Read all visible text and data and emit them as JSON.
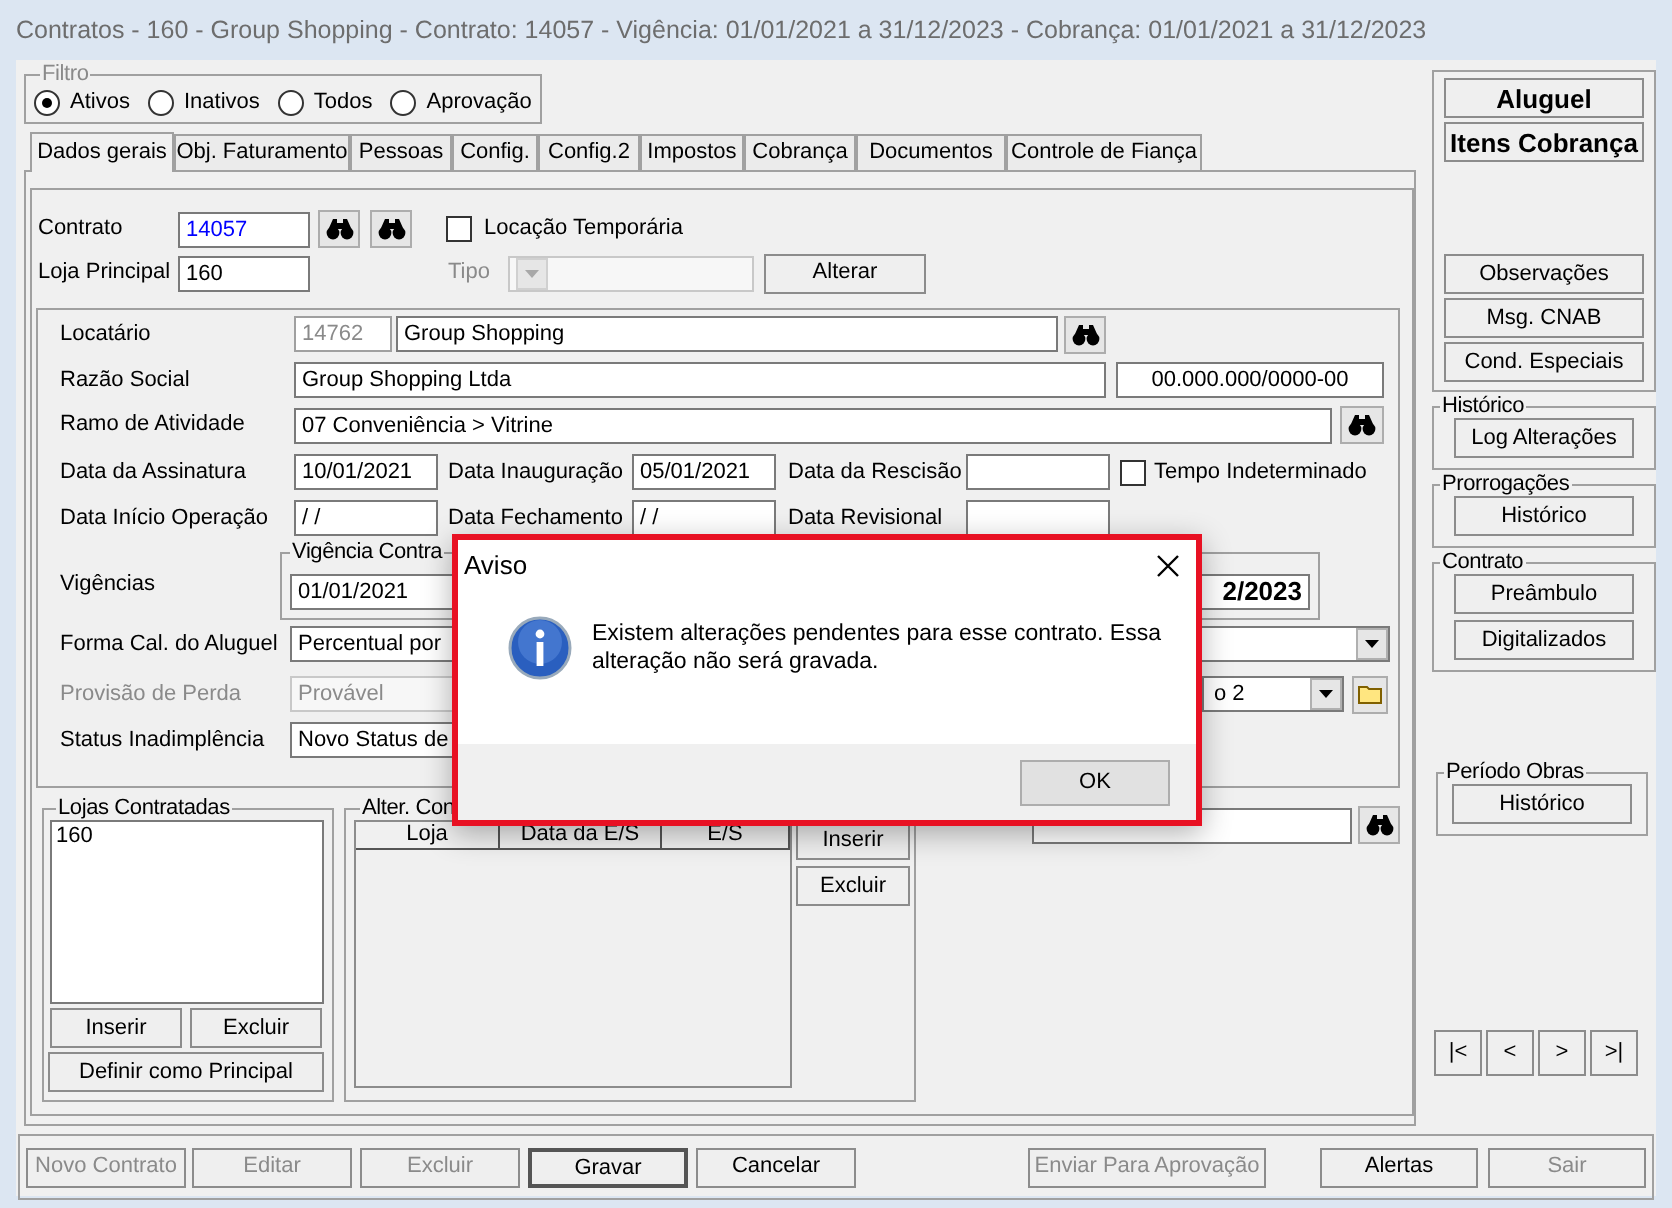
{
  "window": {
    "title": "Contratos - 160 - Group Shopping - Contrato: 14057 - Vigência: 01/01/2021 a 31/12/2023 - Cobrança: 01/01/2021 a 31/12/2023"
  },
  "filter": {
    "label": "Filtro",
    "options": [
      {
        "label": "Ativos",
        "selected": true
      },
      {
        "label": "Inativos",
        "selected": false
      },
      {
        "label": "Todos",
        "selected": false
      },
      {
        "label": "Aprovação",
        "selected": false
      }
    ]
  },
  "tabs": [
    {
      "label": "Dados gerais",
      "selected": true
    },
    {
      "label": "Obj. Faturamento",
      "selected": false
    },
    {
      "label": "Pessoas",
      "selected": false
    },
    {
      "label": "Config.",
      "selected": false
    },
    {
      "label": "Config.2",
      "selected": false
    },
    {
      "label": "Impostos",
      "selected": false
    },
    {
      "label": "Cobrança",
      "selected": false
    },
    {
      "label": "Documentos",
      "selected": false
    },
    {
      "label": "Controle de Fiança",
      "selected": false
    }
  ],
  "contract": {
    "label": "Contrato",
    "value": "14057"
  },
  "temporary_rental": {
    "label": "Locação Temporária",
    "checked": false
  },
  "main_store": {
    "label": "Loja Principal",
    "value": "160"
  },
  "type": {
    "label": "Tipo",
    "disabled": true
  },
  "change_button": {
    "label": "Alterar"
  },
  "tenant": {
    "label": "Locatário",
    "code": "14762",
    "name": "Group Shopping"
  },
  "company_name": {
    "label": "Razão Social",
    "value": "Group Shopping Ltda",
    "tax_id": "00.000.000/0000-00"
  },
  "business": {
    "label": "Ramo de Atividade",
    "value": "07 Conveniência > Vitrine"
  },
  "date_rows": [
    [
      {
        "label": "Data da Assinatura",
        "value": "10/01/2021"
      },
      {
        "label": "Data Inauguração",
        "value": "05/01/2021"
      },
      {
        "label": "Data da Rescisão"
      }
    ],
    [
      {
        "label": "Data Início Operação",
        "value": " /  /"
      },
      {
        "label": "Data Fechamento",
        "value": " /  /"
      },
      {
        "label": "Data Revisional"
      }
    ]
  ],
  "indefinite_term": {
    "label": "Tempo Indeterminado",
    "checked": false
  },
  "terms": {
    "label": "Vigências",
    "group_label": "Vigência Contra",
    "start": "01/01/2021",
    "end": "2/2023"
  },
  "rent_calc": {
    "label": "Forma Cal. do Aluguel",
    "value": "Percentual por"
  },
  "loss_provision": {
    "label": "Provisão de Perda",
    "value": "Provável",
    "disabled": true,
    "second_value": "o 2"
  },
  "default_status": {
    "label": "Status Inadimplência",
    "value": "Novo Status de"
  },
  "stores": {
    "label": "Lojas Contratadas",
    "items": [
      "160"
    ],
    "buttons": [
      "Inserir",
      "Excluir"
    ],
    "set_main": "Definir como Principal"
  },
  "changes": {
    "label": "Alter. Con",
    "columns": [
      "Loja",
      "Data da E/S",
      "E/S"
    ],
    "buttons": [
      "Inserir",
      "Excluir"
    ]
  },
  "side_buttons_top": [
    {
      "label": "Aluguel",
      "bold": true
    },
    {
      "label": "Itens Cobrança",
      "bold": true
    }
  ],
  "side_buttons": [
    "Observações",
    "Msg. CNAB",
    "Cond. Especiais"
  ],
  "side_groups": [
    {
      "label": "Histórico",
      "buttons": [
        "Log Alterações"
      ]
    },
    {
      "label": "Prorrogações",
      "buttons": [
        "Histórico"
      ]
    },
    {
      "label": "Contrato",
      "buttons": [
        "Preâmbulo",
        "Digitalizados"
      ]
    }
  ],
  "works_group": {
    "label": "Período Obras",
    "buttons": [
      "Histórico"
    ]
  },
  "nav_buttons": [
    "|<",
    "<",
    ">",
    ">|"
  ],
  "actions": [
    {
      "label": "Novo Contrato",
      "disabled": true,
      "default": false
    },
    {
      "label": "Editar",
      "disabled": true,
      "default": false
    },
    {
      "label": "Excluir",
      "disabled": true,
      "default": false
    },
    {
      "label": "Gravar",
      "disabled": false,
      "default": true
    },
    {
      "label": "Cancelar",
      "disabled": false,
      "default": false
    },
    {
      "label": "Enviar Para Aprovação",
      "disabled": true,
      "default": false
    },
    {
      "label": "Alertas",
      "disabled": false,
      "default": false
    },
    {
      "label": "Sair",
      "disabled": true,
      "default": false
    }
  ],
  "dialog": {
    "title": "Aviso",
    "message": "Existem alterações pendentes para esse contrato. Essa alteração não será gravada.",
    "button": "OK"
  }
}
